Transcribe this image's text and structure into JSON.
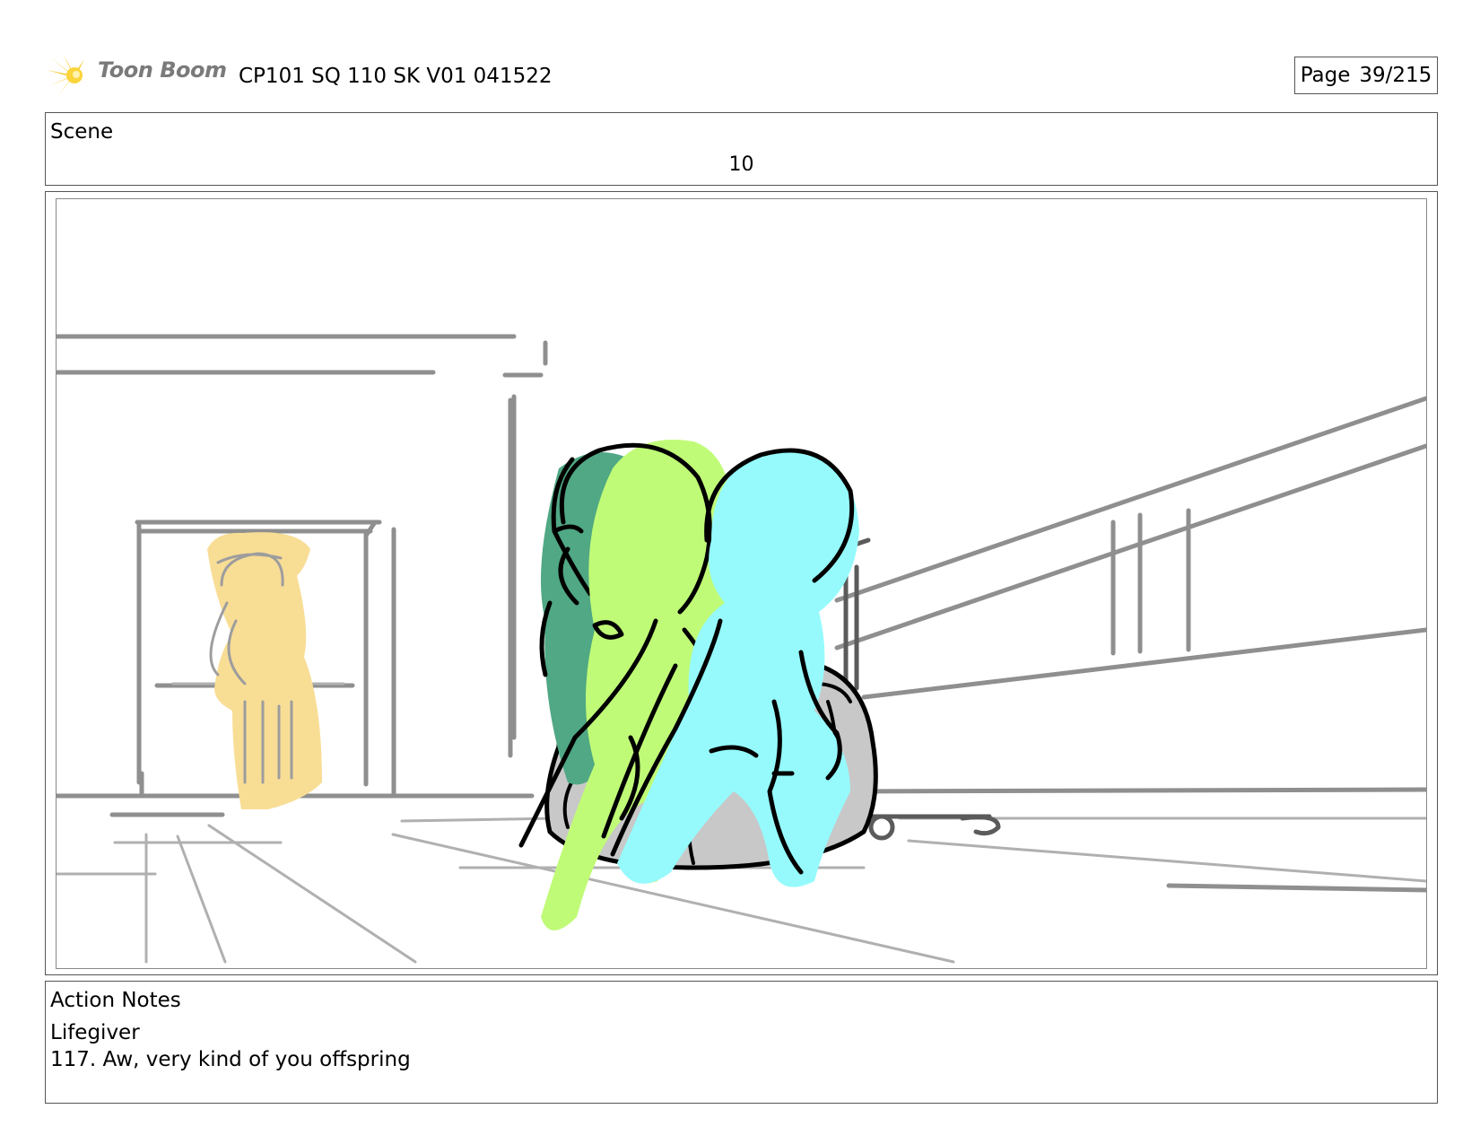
{
  "header": {
    "logo_text": "Toon Boom",
    "title": "CP101 SQ 110 SK V01 041522",
    "page_label": "Page",
    "page_value": "39/215"
  },
  "scene": {
    "label": "Scene",
    "number": "10"
  },
  "panel": {
    "image_name": "storyboard-sketch",
    "colors": {
      "yellow_figure": "#f8dd95",
      "green_figure": "#c0fb77",
      "dark_green_figure": "#50a884",
      "cyan_figure": "#96fafc",
      "seat": "#c8c8c8",
      "line_gray": "#8f8f8f"
    }
  },
  "notes": {
    "heading": "Action Notes",
    "speaker": "Lifegiver",
    "line": "117. Aw, very kind of you offspring"
  }
}
